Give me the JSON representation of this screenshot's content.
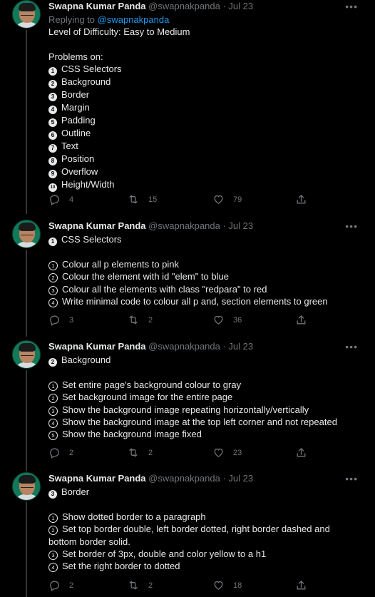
{
  "tweets": [
    {
      "name": "Swapna Kumar Panda",
      "handle": "@swapnakpanda",
      "date": "Jul 23",
      "replying_prefix": "Replying to ",
      "replying_handle": "@swapnakpanda",
      "intro": "Level of Difficulty: Easy to Medium",
      "problems_heading": "Problems on:",
      "items": [
        {
          "n": "1",
          "text": "CSS Selectors"
        },
        {
          "n": "2",
          "text": "Background"
        },
        {
          "n": "3",
          "text": "Border"
        },
        {
          "n": "4",
          "text": "Margin"
        },
        {
          "n": "5",
          "text": "Padding"
        },
        {
          "n": "6",
          "text": "Outline"
        },
        {
          "n": "7",
          "text": "Text"
        },
        {
          "n": "8",
          "text": "Position"
        },
        {
          "n": "9",
          "text": "Overflow"
        },
        {
          "n": "10",
          "text": "Height/Width"
        }
      ],
      "replies": "4",
      "retweets": "15",
      "likes": "79"
    },
    {
      "name": "Swapna Kumar Panda",
      "handle": "@swapnakpanda",
      "date": "Jul 23",
      "title_num": "1",
      "title": "CSS Selectors",
      "items": [
        {
          "n": "1",
          "text": "Colour all p elements to pink"
        },
        {
          "n": "2",
          "text": "Colour the element with id \"elem\" to blue"
        },
        {
          "n": "3",
          "text": "Colour all the elements with class \"redpara\" to red"
        },
        {
          "n": "4",
          "text": "Write minimal code to colour all p and, section elements to green"
        }
      ],
      "replies": "3",
      "retweets": "2",
      "likes": "36"
    },
    {
      "name": "Swapna Kumar Panda",
      "handle": "@swapnakpanda",
      "date": "Jul 23",
      "title_num": "2",
      "title": "Background",
      "items": [
        {
          "n": "1",
          "text": "Set entire page's background colour to gray"
        },
        {
          "n": "2",
          "text": "Set background image for the entire page"
        },
        {
          "n": "3",
          "text": "Show the background image repeating horizontally/vertically"
        },
        {
          "n": "4",
          "text": "Show the background image at the top left corner and not repeated"
        },
        {
          "n": "5",
          "text": "Show the background image fixed"
        }
      ],
      "replies": "2",
      "retweets": "2",
      "likes": "23"
    },
    {
      "name": "Swapna Kumar Panda",
      "handle": "@swapnakpanda",
      "date": "Jul 23",
      "title_num": "3",
      "title": "Border",
      "items": [
        {
          "n": "1",
          "text": "Show dotted border to a paragraph"
        },
        {
          "n": "2",
          "text": "Set top border double, left border dotted, right border dashed and bottom border solid."
        },
        {
          "n": "3",
          "text": "Set border of 3px, double and color yellow to a h1"
        },
        {
          "n": "4",
          "text": "Set the right border to dotted"
        }
      ],
      "replies": "2",
      "retweets": "2",
      "likes": "18"
    }
  ],
  "icons": {
    "reply": "reply-icon",
    "retweet": "retweet-icon",
    "like": "heart-icon",
    "share": "share-icon",
    "more": "more-icon"
  },
  "colors": {
    "background": "#000000",
    "text": "#e7e9ea",
    "muted": "#71767b",
    "link": "#1d9bf0",
    "divider": "#2f3336"
  }
}
